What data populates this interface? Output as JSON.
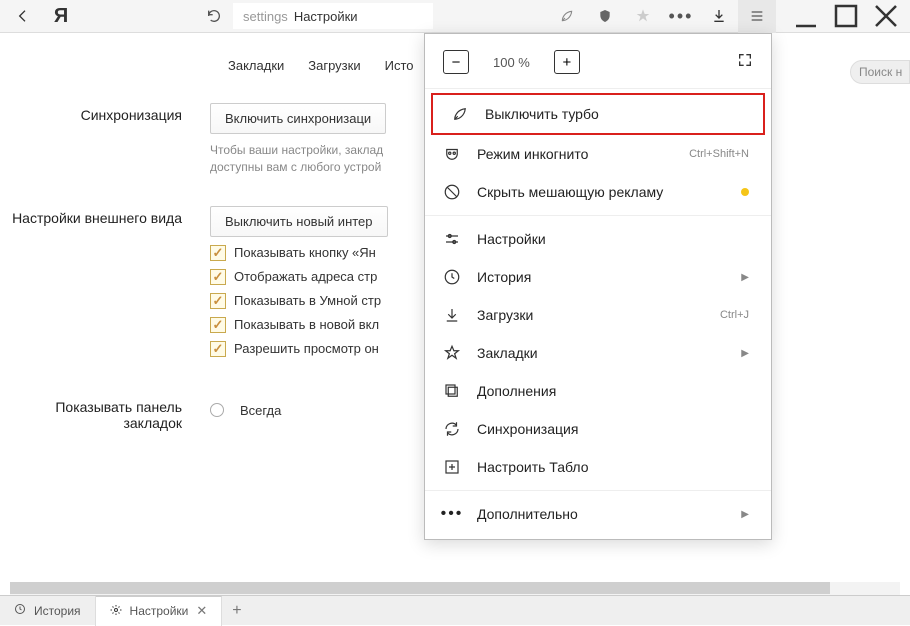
{
  "address": {
    "prefix": "settings",
    "title": "Настройки"
  },
  "tabs": {
    "bookmarks": "Закладки",
    "downloads": "Загрузки",
    "history_cut": "Исто"
  },
  "search_placeholder": "Поиск н",
  "sync": {
    "label": "Синхронизация",
    "button": "Включить синхронизаци",
    "hint": "Чтобы ваши настройки, заклад\nдоступны вам с любого устрой"
  },
  "appearance": {
    "label": "Настройки внешнего вида",
    "button": "Выключить новый интер",
    "opts": [
      "Показывать кнопку «Ян",
      "Отображать адреса стр",
      "Показывать в Умной стр",
      "Показывать в новой вкл",
      "Разрешить просмотр он"
    ]
  },
  "bookmarkbar": {
    "label": "Показывать панель закладок",
    "always": "Всегда"
  },
  "menu": {
    "zoom": "100 %",
    "turbo": "Выключить турбо",
    "incognito": {
      "label": "Режим инкогнито",
      "shortcut": "Ctrl+Shift+N"
    },
    "ads": "Скрыть мешающую рекламу",
    "settings": "Настройки",
    "history": "История",
    "downloads": {
      "label": "Загрузки",
      "shortcut": "Ctrl+J"
    },
    "bookmarks": "Закладки",
    "addons": "Дополнения",
    "sync": "Синхронизация",
    "tableau": "Настроить Табло",
    "more": "Дополнительно"
  },
  "bottom": {
    "history": "История",
    "settings": "Настройки"
  }
}
